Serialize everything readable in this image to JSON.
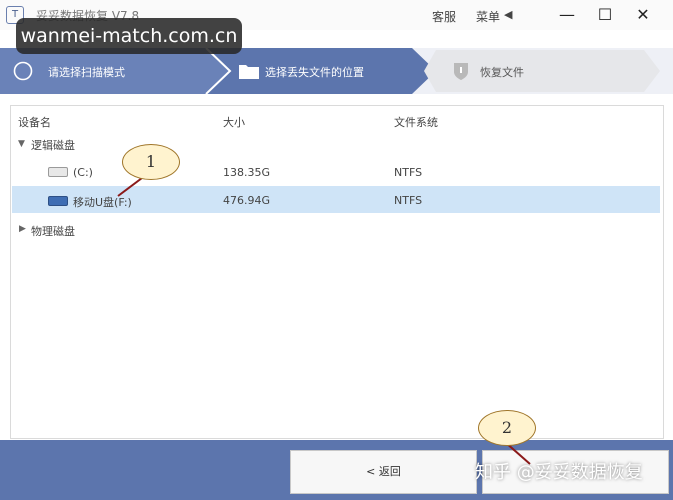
{
  "app": {
    "title": "妥妥数据恢复 V7.8",
    "icon": "T"
  },
  "titlebar": {
    "service": "客服",
    "menu": "菜单",
    "menu_icon": "◀",
    "min": "—",
    "max": "☐",
    "close": "✕"
  },
  "watermark": "wanmei-match.com.cn",
  "steps": [
    {
      "label": "请选择扫描模式",
      "state": "done"
    },
    {
      "label": "选择丢失文件的位置",
      "state": "active"
    },
    {
      "label": "恢复文件",
      "state": "pending"
    }
  ],
  "table": {
    "columns": [
      "设备名",
      "大小",
      "文件系统"
    ],
    "groups": [
      {
        "name": "逻辑磁盘",
        "expanded": true
      },
      {
        "name": "物理磁盘",
        "expanded": false
      }
    ],
    "rows": [
      {
        "name": "(C:)",
        "size": "138.35G",
        "fs": "NTFS",
        "selected": false
      },
      {
        "name": "移动U盘(F:)",
        "size": "476.94G",
        "fs": "NTFS",
        "selected": true
      }
    ]
  },
  "callouts": {
    "one": "1",
    "two": "2"
  },
  "buttons": {
    "back": "< 返回"
  },
  "bottom_watermark": "知乎 @妥妥数据恢复",
  "colors": {
    "accent": "#5c75ad",
    "selection": "#cfe4f7",
    "callout_fill": "#fff3cf",
    "callout_line": "#8b1a1a"
  }
}
